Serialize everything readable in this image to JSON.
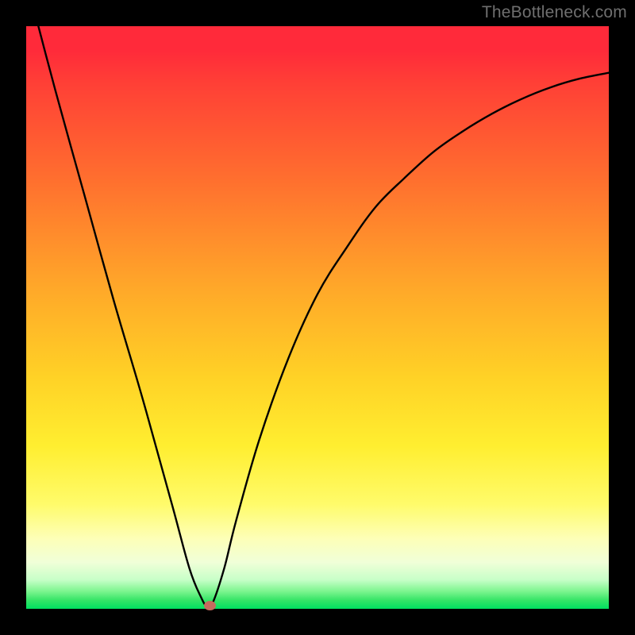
{
  "watermark": "TheBottleneck.com",
  "colors": {
    "frame": "#000000",
    "gradient_top": "#ff2a3a",
    "gradient_bottom": "#00e060",
    "curve": "#000000",
    "marker": "#c46a5e",
    "watermark_text": "#6f6f6f"
  },
  "chart_data": {
    "type": "line",
    "title": "",
    "xlabel": "",
    "ylabel": "",
    "xlim": [
      0,
      100
    ],
    "ylim": [
      0,
      100
    ],
    "grid": false,
    "legend": false,
    "annotations": [
      "TheBottleneck.com"
    ],
    "series": [
      {
        "name": "bottleneck-curve",
        "x": [
          0,
          5,
          10,
          15,
          20,
          25,
          28,
          30,
          31,
          32,
          34,
          36,
          40,
          45,
          50,
          55,
          60,
          65,
          70,
          75,
          80,
          85,
          90,
          95,
          100
        ],
        "y": [
          108,
          89,
          71,
          53,
          36,
          18,
          7,
          2,
          0.5,
          1,
          7,
          15,
          29,
          43,
          54,
          62,
          69,
          74,
          78.5,
          82,
          85,
          87.5,
          89.5,
          91,
          92
        ]
      }
    ],
    "marker": {
      "x": 31.5,
      "y": 0.5
    }
  }
}
